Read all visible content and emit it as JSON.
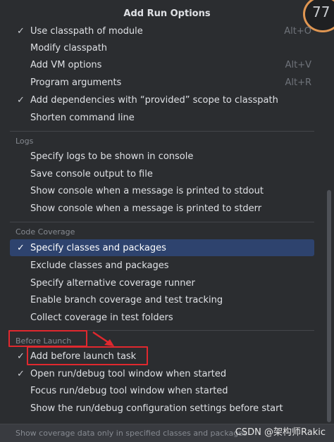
{
  "popup": {
    "title": "Add Run Options",
    "badge_text": "77",
    "footer_text": "Show coverage data only in specified classes and packages",
    "watermark": "CSDN @架构师Rakic"
  },
  "items": {
    "classpath_module": {
      "label": "Use classpath of module",
      "shortcut": "Alt+O",
      "checked": true
    },
    "modify_classpath": {
      "label": "Modify classpath",
      "shortcut": "",
      "checked": false
    },
    "vm_options": {
      "label": "Add VM options",
      "shortcut": "Alt+V",
      "checked": false
    },
    "program_args": {
      "label": "Program arguments",
      "shortcut": "Alt+R",
      "checked": true
    },
    "provided_scope": {
      "label": "Add dependencies with “provided” scope to classpath",
      "shortcut": "",
      "checked": true
    },
    "shorten_cmd": {
      "label": "Shorten command line",
      "shortcut": "",
      "checked": false
    },
    "logs_console": {
      "label": "Specify logs to be shown in console",
      "checked": false
    },
    "save_console": {
      "label": "Save console output to file",
      "checked": false
    },
    "show_stdout": {
      "label": "Show console when a message is printed to stdout",
      "checked": false
    },
    "show_stderr": {
      "label": "Show console when a message is printed to stderr",
      "checked": false
    },
    "specify_classes": {
      "label": "Specify classes and packages",
      "checked": true
    },
    "exclude_classes": {
      "label": "Exclude classes and packages",
      "checked": false
    },
    "alt_runner": {
      "label": "Specify alternative coverage runner",
      "checked": false
    },
    "branch_coverage": {
      "label": "Enable branch coverage and test tracking",
      "checked": false
    },
    "test_folders": {
      "label": "Collect coverage in test folders",
      "checked": false
    },
    "before_launch_task": {
      "label": "Add before launch task",
      "checked": true
    },
    "open_tool_window": {
      "label": "Open run/debug tool window when started",
      "checked": true
    },
    "focus_tool_window": {
      "label": "Focus run/debug tool window when started",
      "checked": false
    },
    "show_config": {
      "label": "Show the run/debug configuration settings before start",
      "checked": false
    }
  },
  "sections": {
    "logs": "Logs",
    "code_coverage": "Code Coverage",
    "before_launch": "Before Launch"
  },
  "check_glyph": "✓",
  "colors": {
    "background": "#2b2d30",
    "selection": "#2e436e",
    "annotation": "#e0282e",
    "badge_ring": "#e09652"
  }
}
